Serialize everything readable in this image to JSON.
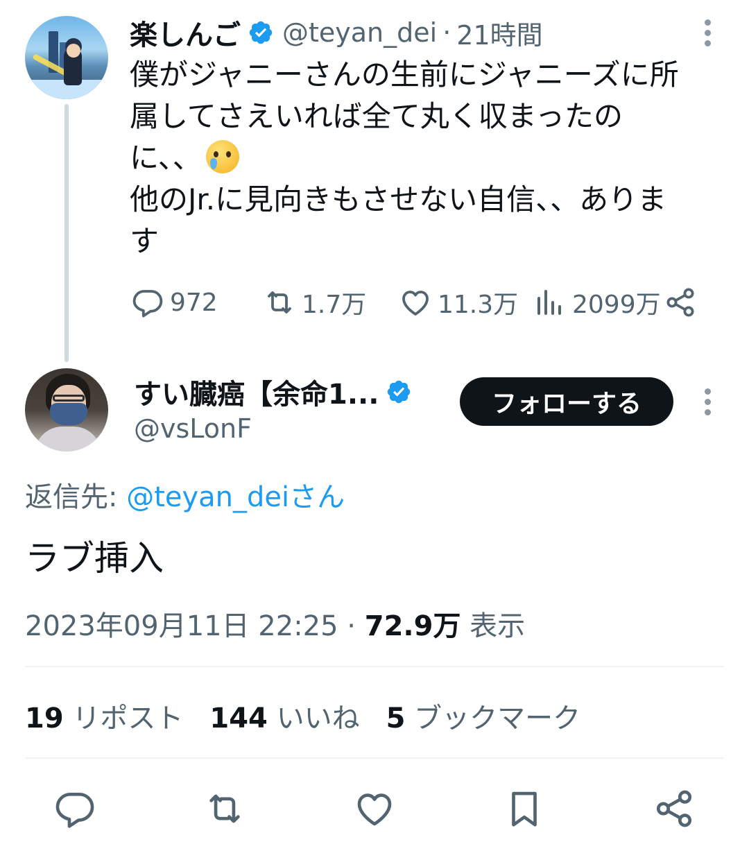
{
  "parent_tweet": {
    "display_name": "楽しんご",
    "handle": "@teyan_dei",
    "separator": "·",
    "time": "21時間",
    "text_lines": [
      "僕がジャニーさんの生前にジャニーズに所",
      "属してさえいれば全て丸く収まったの",
      "に、、",
      "他のJr.に見向きもさせない自信、、ありま",
      "す"
    ],
    "emoji": "face-holding-back-tears",
    "actions": {
      "replies": "972",
      "reposts": "1.7万",
      "likes": "11.3万",
      "views": "2099万"
    }
  },
  "reply_tweet": {
    "display_name": "すい臓癌【余命1...",
    "handle": "@vsLonF",
    "follow_label": "フォローする",
    "reply_to_label": "返信先: ",
    "reply_to_mention": "@teyan_deiさん",
    "text": "ラブ挿入",
    "timestamp": "2023年09月11日 22:25",
    "meta_separator": " · ",
    "views_count": "72.9万",
    "views_label": " 表示",
    "stats": {
      "reposts_count": "19",
      "reposts_label": " リポスト",
      "likes_count": "144",
      "likes_label": " いいね",
      "bookmarks_count": "5",
      "bookmarks_label": " ブックマーク"
    }
  },
  "colors": {
    "text": "#0f1419",
    "secondary": "#536471",
    "link": "#1d9bf0",
    "verified": "#1d9bf0",
    "divider": "#eff3f4",
    "thread_line": "#cfd9de",
    "follow_bg": "#0f1419"
  }
}
